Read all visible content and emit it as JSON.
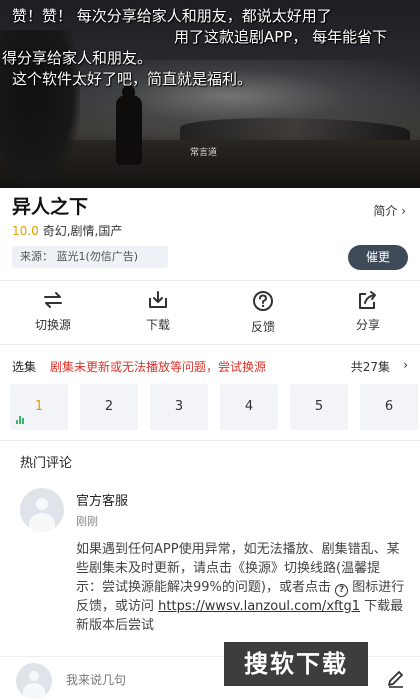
{
  "video": {
    "caption_line1": "赞！赞！    每次分享给家人和朋友，都说太好用了",
    "caption_line2": "用了这款追剧APP，  每年能省下",
    "caption_line3": "得分享给家人和朋友。",
    "caption_line4": "这个软件太好了吧，简直就是福利。",
    "subtitle": "常言道"
  },
  "show": {
    "title": "异人之下",
    "intro_label": "简介 ›",
    "score": "10.0",
    "genres": "奇幻,剧情,国产",
    "source": "来源：  蓝光1(勿信广告)",
    "urge_label": "催更"
  },
  "actions": [
    {
      "label": "切换源",
      "icon": "switch-source-icon"
    },
    {
      "label": "下载",
      "icon": "download-icon"
    },
    {
      "label": "反馈",
      "icon": "feedback-question-icon"
    },
    {
      "label": "分享",
      "icon": "share-icon"
    }
  ],
  "episodes": {
    "select_label": "选集",
    "warning": "剧集未更新或无法播放等问题，尝试换源",
    "total": "共27集",
    "more": "›",
    "visible": [
      "1",
      "2",
      "3",
      "4",
      "5",
      "6"
    ],
    "active_index": 0
  },
  "comments": {
    "section_title": "热门评论",
    "items": [
      {
        "name": "官方客服",
        "time": "刚刚",
        "body_1": "如果遇到任何APP使用异常，如无法播放、剧集错乱、某些剧集未及时更新，请点击《换源》切换线路(温馨提示：尝试换源能解决99%的问题)，或者点击 ",
        "body_icon": "?",
        "body_2": " 图标进行反馈，或访问 ",
        "link": "https://wwsv.lanzoul.com/xftg1",
        "body_3": " 下载最新版本后尝试"
      }
    ]
  },
  "bottom": {
    "input_placeholder": "我来说几句",
    "watermark": "搜软下载"
  },
  "colors": {
    "accent": "#e6a000",
    "warning": "#e0332c",
    "urge_bg": "#3e4a58"
  }
}
